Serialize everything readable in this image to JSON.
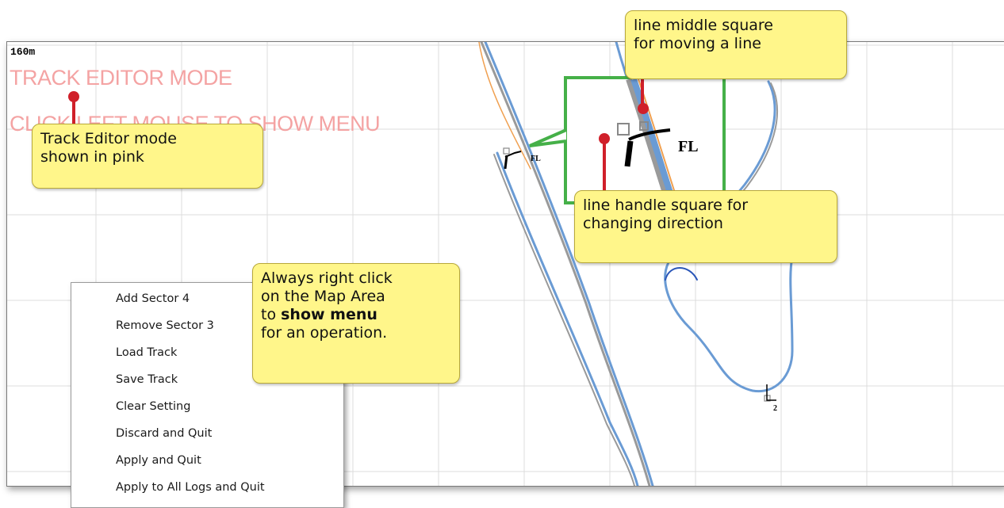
{
  "map": {
    "scale_label": "160m",
    "mode_text": "TRACK EDITOR MODE",
    "mode_hint": "CLICK LEFT MOUSE TO SHOW MENU",
    "sector_label_left": "FL",
    "sector_label_zoom": "FL",
    "point_label": "2"
  },
  "context_menu": {
    "items": [
      "Add Sector 4",
      "Remove Sector 3",
      "Load Track",
      "Save Track",
      "Clear Setting",
      "Discard and Quit",
      "Apply and Quit",
      "Apply to All Logs and Quit"
    ]
  },
  "callouts": {
    "track_editor": [
      "Track Editor mode",
      "shown in pink"
    ],
    "line_middle": [
      "line middle square",
      "for moving a line"
    ],
    "line_handle": [
      "line handle square for",
      "changing direction"
    ],
    "right_click": {
      "line1": "Always right click",
      "line2": "on the Map Area",
      "line3_prefix": "to ",
      "line3_bold": "show menu",
      "line4": "for an operation."
    }
  },
  "colors": {
    "mode_text": "#f4a3a3",
    "callout_bg": "#fff68a",
    "pin": "#d0202a",
    "zoom_border": "#45b048",
    "track_blue": "#6a9bd4",
    "track_gray": "#9a9a9a",
    "track_orange": "#f0a050"
  }
}
